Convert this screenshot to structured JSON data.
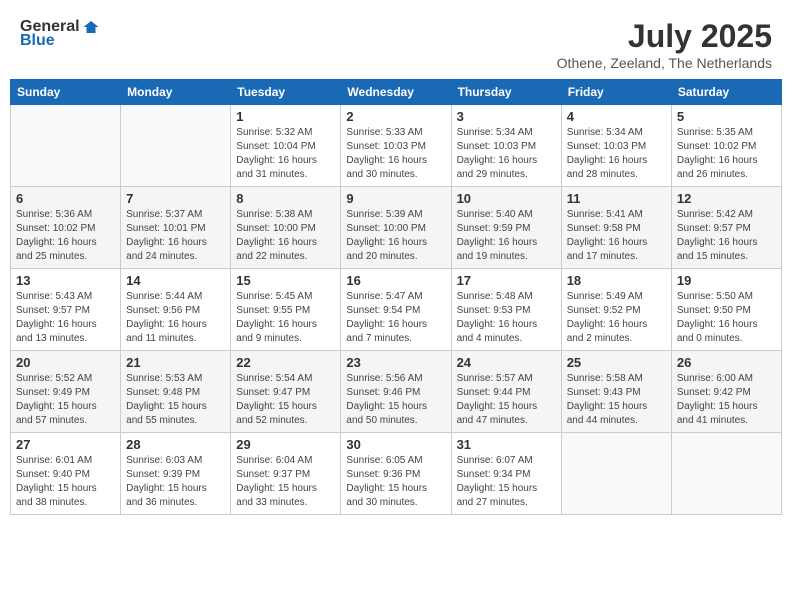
{
  "header": {
    "logo_general": "General",
    "logo_blue": "Blue",
    "title": "July 2025",
    "location": "Othene, Zeeland, The Netherlands"
  },
  "weekdays": [
    "Sunday",
    "Monday",
    "Tuesday",
    "Wednesday",
    "Thursday",
    "Friday",
    "Saturday"
  ],
  "weeks": [
    [
      {
        "day": "",
        "info": ""
      },
      {
        "day": "",
        "info": ""
      },
      {
        "day": "1",
        "info": "Sunrise: 5:32 AM\nSunset: 10:04 PM\nDaylight: 16 hours\nand 31 minutes."
      },
      {
        "day": "2",
        "info": "Sunrise: 5:33 AM\nSunset: 10:03 PM\nDaylight: 16 hours\nand 30 minutes."
      },
      {
        "day": "3",
        "info": "Sunrise: 5:34 AM\nSunset: 10:03 PM\nDaylight: 16 hours\nand 29 minutes."
      },
      {
        "day": "4",
        "info": "Sunrise: 5:34 AM\nSunset: 10:03 PM\nDaylight: 16 hours\nand 28 minutes."
      },
      {
        "day": "5",
        "info": "Sunrise: 5:35 AM\nSunset: 10:02 PM\nDaylight: 16 hours\nand 26 minutes."
      }
    ],
    [
      {
        "day": "6",
        "info": "Sunrise: 5:36 AM\nSunset: 10:02 PM\nDaylight: 16 hours\nand 25 minutes."
      },
      {
        "day": "7",
        "info": "Sunrise: 5:37 AM\nSunset: 10:01 PM\nDaylight: 16 hours\nand 24 minutes."
      },
      {
        "day": "8",
        "info": "Sunrise: 5:38 AM\nSunset: 10:00 PM\nDaylight: 16 hours\nand 22 minutes."
      },
      {
        "day": "9",
        "info": "Sunrise: 5:39 AM\nSunset: 10:00 PM\nDaylight: 16 hours\nand 20 minutes."
      },
      {
        "day": "10",
        "info": "Sunrise: 5:40 AM\nSunset: 9:59 PM\nDaylight: 16 hours\nand 19 minutes."
      },
      {
        "day": "11",
        "info": "Sunrise: 5:41 AM\nSunset: 9:58 PM\nDaylight: 16 hours\nand 17 minutes."
      },
      {
        "day": "12",
        "info": "Sunrise: 5:42 AM\nSunset: 9:57 PM\nDaylight: 16 hours\nand 15 minutes."
      }
    ],
    [
      {
        "day": "13",
        "info": "Sunrise: 5:43 AM\nSunset: 9:57 PM\nDaylight: 16 hours\nand 13 minutes."
      },
      {
        "day": "14",
        "info": "Sunrise: 5:44 AM\nSunset: 9:56 PM\nDaylight: 16 hours\nand 11 minutes."
      },
      {
        "day": "15",
        "info": "Sunrise: 5:45 AM\nSunset: 9:55 PM\nDaylight: 16 hours\nand 9 minutes."
      },
      {
        "day": "16",
        "info": "Sunrise: 5:47 AM\nSunset: 9:54 PM\nDaylight: 16 hours\nand 7 minutes."
      },
      {
        "day": "17",
        "info": "Sunrise: 5:48 AM\nSunset: 9:53 PM\nDaylight: 16 hours\nand 4 minutes."
      },
      {
        "day": "18",
        "info": "Sunrise: 5:49 AM\nSunset: 9:52 PM\nDaylight: 16 hours\nand 2 minutes."
      },
      {
        "day": "19",
        "info": "Sunrise: 5:50 AM\nSunset: 9:50 PM\nDaylight: 16 hours\nand 0 minutes."
      }
    ],
    [
      {
        "day": "20",
        "info": "Sunrise: 5:52 AM\nSunset: 9:49 PM\nDaylight: 15 hours\nand 57 minutes."
      },
      {
        "day": "21",
        "info": "Sunrise: 5:53 AM\nSunset: 9:48 PM\nDaylight: 15 hours\nand 55 minutes."
      },
      {
        "day": "22",
        "info": "Sunrise: 5:54 AM\nSunset: 9:47 PM\nDaylight: 15 hours\nand 52 minutes."
      },
      {
        "day": "23",
        "info": "Sunrise: 5:56 AM\nSunset: 9:46 PM\nDaylight: 15 hours\nand 50 minutes."
      },
      {
        "day": "24",
        "info": "Sunrise: 5:57 AM\nSunset: 9:44 PM\nDaylight: 15 hours\nand 47 minutes."
      },
      {
        "day": "25",
        "info": "Sunrise: 5:58 AM\nSunset: 9:43 PM\nDaylight: 15 hours\nand 44 minutes."
      },
      {
        "day": "26",
        "info": "Sunrise: 6:00 AM\nSunset: 9:42 PM\nDaylight: 15 hours\nand 41 minutes."
      }
    ],
    [
      {
        "day": "27",
        "info": "Sunrise: 6:01 AM\nSunset: 9:40 PM\nDaylight: 15 hours\nand 38 minutes."
      },
      {
        "day": "28",
        "info": "Sunrise: 6:03 AM\nSunset: 9:39 PM\nDaylight: 15 hours\nand 36 minutes."
      },
      {
        "day": "29",
        "info": "Sunrise: 6:04 AM\nSunset: 9:37 PM\nDaylight: 15 hours\nand 33 minutes."
      },
      {
        "day": "30",
        "info": "Sunrise: 6:05 AM\nSunset: 9:36 PM\nDaylight: 15 hours\nand 30 minutes."
      },
      {
        "day": "31",
        "info": "Sunrise: 6:07 AM\nSunset: 9:34 PM\nDaylight: 15 hours\nand 27 minutes."
      },
      {
        "day": "",
        "info": ""
      },
      {
        "day": "",
        "info": ""
      }
    ]
  ]
}
